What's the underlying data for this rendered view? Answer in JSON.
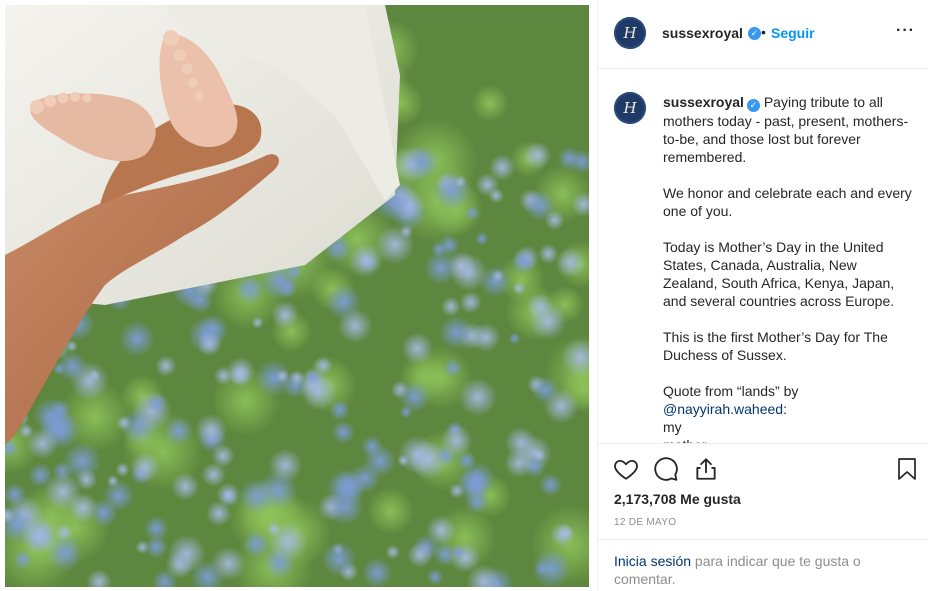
{
  "post": {
    "image_alt": "Baby feet held in a hand over blue forget-me-not flowers"
  },
  "header": {
    "avatar_letter": "H",
    "username": "sussexroyal",
    "verified_icon": "verified-badge-icon",
    "separator": "•",
    "follow_label": "Seguir",
    "more_icon": "more-options-icon"
  },
  "caption": {
    "avatar_letter": "H",
    "username": "sussexroyal",
    "p1": " Paying tribute to all mothers today - past, present, mothers-to-be, and those lost but forever remembered.",
    "p2": "We honor and celebrate each and every one of you.",
    "p3": "Today is Mother’s Day in the United States, Canada, Australia, New Zealand, South Africa, Kenya, Japan, and several countries across Europe.",
    "p4": "This is the first Mother’s Day for The Duchess of Sussex.",
    "p5_intro": "Quote from “lands” by",
    "p5_mention": "@nayyirah.waheed",
    "p5_colon": ":",
    "p5_line1": "my",
    "p5_line2": "mother"
  },
  "actions": {
    "like_icon": "heart-icon",
    "comment_icon": "comment-icon",
    "share_icon": "share-icon",
    "save_icon": "bookmark-icon"
  },
  "stats": {
    "likes": "2,173,708 Me gusta",
    "date": "12 DE MAYO"
  },
  "login": {
    "link": "Inicia sesión",
    "text": " para indicar que te gusta o comentar."
  },
  "colors": {
    "link_blue": "#0095f6",
    "verified_blue": "#3897f0",
    "muted_gray": "#8e8e8e",
    "avatar_navy": "#1f3a66"
  }
}
